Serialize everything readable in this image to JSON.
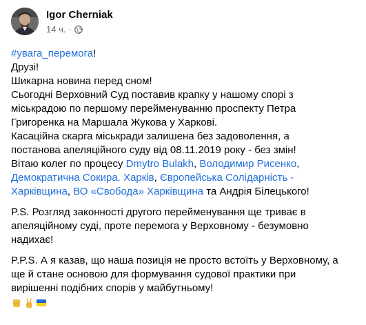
{
  "post": {
    "author": "Igor Cherniak",
    "time": "14 ч.",
    "dot": "·",
    "hashtag": "#увага_перемога",
    "hashtag_tail": "!",
    "lines": {
      "l1": "Друзі!",
      "l2": "Шикарна новина перед сном!",
      "l3": "Сьогодні Верховний Суд поставив крапку у нашому спорі з",
      "l4": "міськрадою по першому перейменуванню проспекту Петра",
      "l5": "Григоренка на Маршала Жукова у Харкові.",
      "l6": "Касаційна скарга міськради залишена без задоволення, а",
      "l7": "постанова апеляційного суду від 08.11.2019 року - без змін!",
      "l8_prefix": "Вітаю колег по процесу ",
      "l8_link1": "Dmytro  Bulakh",
      "l8_sep": ", ",
      "l8_link2": "Володимир Рисенко",
      "l8_tail": ",",
      "l9_link": "Демократична Сокира. Харків",
      "l9_sep": ", ",
      "l9_link2": "Європейська Солідарність -",
      "l10_link": "Харківщина",
      "l10_sep": ", ",
      "l10_link2": "ВО «Свобода» Харківщина",
      "l10_tail": " та Андрія Білецького!"
    },
    "ps": {
      "l1": "P.S. Розгляд законності другого перейменування ще триває в",
      "l2": "апеляційному суді, проте перемога у Верховному - безумовно",
      "l3": "надихає!"
    },
    "pps": {
      "l1": "P.P.S. А я казав, що наша позиція не просто встоїть у Верховному, а",
      "l2": "ще й стане основою для формування судової практики при",
      "l3": "вирішенні подібних спорів у майбутньому!"
    },
    "emojis": [
      "raised-fist",
      "victory-hand",
      "ukraine-flag"
    ]
  },
  "colors": {
    "link": "#216fdb",
    "text": "#050505",
    "meta": "#65676b"
  }
}
